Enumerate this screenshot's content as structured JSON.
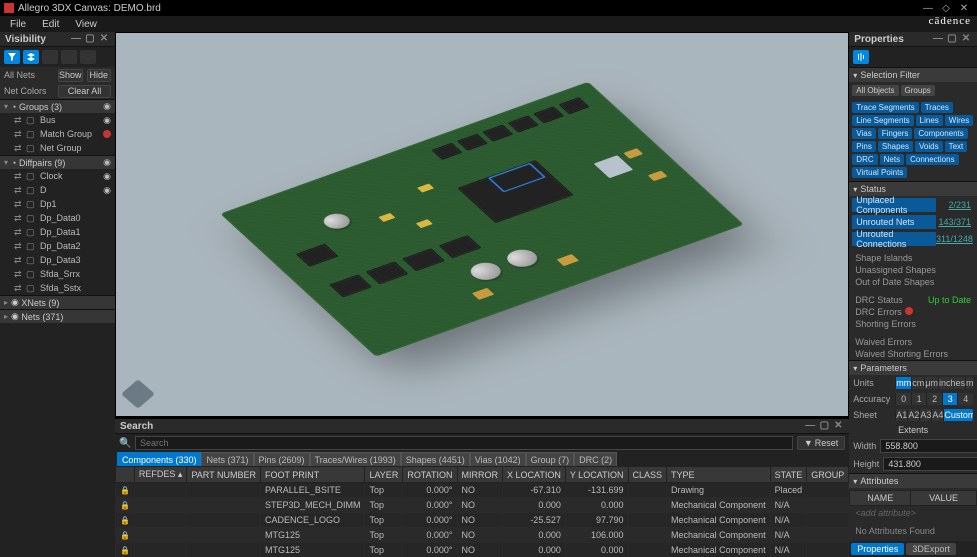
{
  "title": "Allegro 3DX Canvas: DEMO.brd",
  "menu": [
    "File",
    "Edit",
    "View"
  ],
  "brand": "cādence",
  "visibility": {
    "title": "Visibility",
    "allnets": "All Nets",
    "show": "Show",
    "hide": "Hide",
    "netcolors": "Net Colors",
    "clearall": "Clear All",
    "groups": {
      "label": "Groups (3)",
      "items": [
        {
          "name": "Bus",
          "eye": true
        },
        {
          "name": "Match Group",
          "dot": true
        },
        {
          "name": "Net Group"
        }
      ]
    },
    "diffpairs": {
      "label": "Diffpairs (9)",
      "items": [
        {
          "name": "Clock",
          "eye": true
        },
        {
          "name": "D",
          "eye": true
        },
        {
          "name": "Dp1"
        },
        {
          "name": "Dp_Data0"
        },
        {
          "name": "Dp_Data1"
        },
        {
          "name": "Dp_Data2"
        },
        {
          "name": "Dp_Data3"
        },
        {
          "name": "Sfda_Srrx"
        },
        {
          "name": "Sfda_Sstx"
        }
      ]
    },
    "xnets": "XNets (9)",
    "nets": "Nets (371)"
  },
  "search": {
    "title": "Search",
    "placeholder": "Search",
    "reset": "Reset",
    "tabs": [
      {
        "label": "Components (330)",
        "sel": true
      },
      {
        "label": "Nets (371)"
      },
      {
        "label": "Pins (2609)"
      },
      {
        "label": "Traces/Wires (1993)"
      },
      {
        "label": "Shapes (4451)"
      },
      {
        "label": "Vias (1042)"
      },
      {
        "label": "Group (7)"
      },
      {
        "label": "DRC (2)"
      }
    ],
    "cols": [
      "",
      "REFDES ▴",
      "PART NUMBER",
      "FOOT PRINT",
      "LAYER",
      "ROTATION",
      "MIRROR",
      "X LOCATION",
      "Y LOCATION",
      "CLASS",
      "TYPE",
      "STATE",
      "GROUP"
    ],
    "rows": [
      {
        "refdes": "",
        "pn": "",
        "fp": "PARALLEL_BSITE",
        "layer": "Top",
        "rot": "0.000°",
        "mir": "NO",
        "x": "-67.310",
        "y": "-131.699",
        "cls": "",
        "type": "Drawing",
        "state": "Placed",
        "grp": ""
      },
      {
        "refdes": "",
        "pn": "",
        "fp": "STEP3D_MECH_DIMM",
        "layer": "Top",
        "rot": "0.000°",
        "mir": "NO",
        "x": "0.000",
        "y": "0.000",
        "cls": "",
        "type": "Mechanical Component",
        "state": "N/A",
        "grp": ""
      },
      {
        "refdes": "",
        "pn": "",
        "fp": "CADENCE_LOGO",
        "layer": "Top",
        "rot": "0.000°",
        "mir": "NO",
        "x": "-25.527",
        "y": "97.790",
        "cls": "",
        "type": "Mechanical Component",
        "state": "N/A",
        "grp": ""
      },
      {
        "refdes": "",
        "pn": "",
        "fp": "MTG125",
        "layer": "Top",
        "rot": "0.000°",
        "mir": "NO",
        "x": "0.000",
        "y": "106.000",
        "cls": "",
        "type": "Mechanical Component",
        "state": "N/A",
        "grp": ""
      },
      {
        "refdes": "",
        "pn": "",
        "fp": "MTG125",
        "layer": "Top",
        "rot": "0.000°",
        "mir": "NO",
        "x": "0.000",
        "y": "0.000",
        "cls": "",
        "type": "Mechanical Component",
        "state": "N/A",
        "grp": ""
      }
    ]
  },
  "properties": {
    "title": "Properties",
    "selfilter": {
      "title": "Selection Filter",
      "row1": [
        {
          "l": "All Objects",
          "g": true
        },
        {
          "l": "Groups",
          "g": true
        }
      ],
      "chips": [
        "Trace Segments",
        "Traces",
        "Line Segments",
        "Lines",
        "Wires",
        "Vias",
        "Fingers",
        "Components",
        "Pins",
        "Shapes",
        "Voids",
        "Text",
        "DRC",
        "Nets",
        "Connections",
        "Virtual Points"
      ]
    },
    "status": {
      "title": "Status",
      "bars": [
        {
          "label": "Unplaced Components",
          "val": "2/231"
        },
        {
          "label": "Unrouted Nets",
          "val": "143/371"
        },
        {
          "label": "Unrouted Connections",
          "val": "311/1248"
        }
      ],
      "shapelines": [
        "Shape Islands",
        "Unassigned Shapes",
        "Out of Date Shapes"
      ],
      "drc": {
        "status": "DRC Status",
        "statusval": "Up to Date",
        "errors": "DRC Errors",
        "shorting": "Shorting Errors",
        "waived": "Waived Errors",
        "waivedshort": "Waived Shorting Errors"
      }
    },
    "parameters": {
      "title": "Parameters",
      "units": {
        "label": "Units",
        "opts": [
          "mm",
          "cm",
          "μm",
          "inches",
          "mils"
        ]
      },
      "accuracy": {
        "label": "Accuracy",
        "opts": [
          "0",
          "1",
          "2",
          "3",
          "4"
        ]
      },
      "sheet": {
        "label": "Sheet",
        "opts": [
          "A1",
          "A2",
          "A3",
          "A4",
          "Custom"
        ]
      },
      "extents": "Extents",
      "width": {
        "label": "Width",
        "val": "558.800"
      },
      "height": {
        "label": "Height",
        "val": "431.800"
      }
    },
    "attributes": {
      "title": "Attributes",
      "cols": [
        "NAME",
        "VALUE"
      ],
      "add": "<add attribute>",
      "none": "No Attributes Found"
    }
  },
  "foottabs": [
    "Properties",
    "3DExport"
  ]
}
